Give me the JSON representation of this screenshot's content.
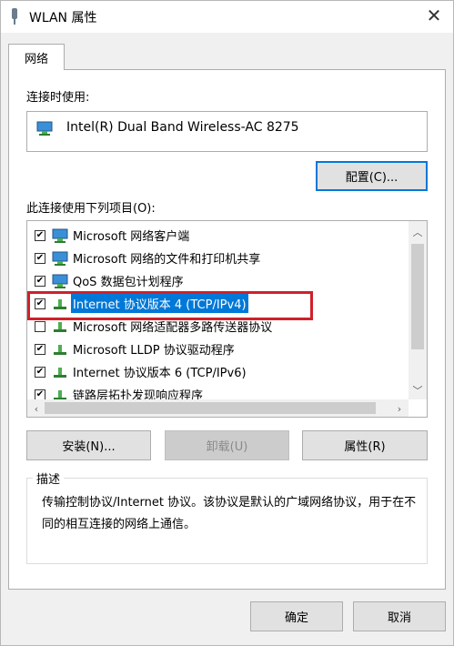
{
  "window": {
    "title": "WLAN 属性",
    "close_glyph": "✕"
  },
  "tabs": [
    {
      "label": "网络"
    }
  ],
  "connect_using": {
    "label": "连接时使用:",
    "adapter": "Intel(R) Dual Band Wireless-AC 8275",
    "icon": "network-adapter-icon"
  },
  "configure_label": "配置(C)...",
  "items_label": "此连接使用下列项目(O):",
  "items": [
    {
      "label": "Microsoft 网络客户端",
      "checked": true,
      "icon": "network-client-icon"
    },
    {
      "label": "Microsoft 网络的文件和打印机共享",
      "checked": true,
      "icon": "network-client-icon"
    },
    {
      "label": "QoS 数据包计划程序",
      "checked": true,
      "icon": "network-client-icon"
    },
    {
      "label": "Internet 协议版本 4 (TCP/IPv4)",
      "checked": true,
      "selected": true,
      "icon": "protocol-icon"
    },
    {
      "label": "Microsoft 网络适配器多路传送器协议",
      "checked": false,
      "icon": "protocol-icon"
    },
    {
      "label": "Microsoft LLDP 协议驱动程序",
      "checked": true,
      "icon": "protocol-icon"
    },
    {
      "label": "Internet 协议版本 6 (TCP/IPv6)",
      "checked": true,
      "icon": "protocol-icon"
    },
    {
      "label": "链路层拓扑发现响应程序",
      "checked": true,
      "icon": "protocol-icon"
    }
  ],
  "buttons": {
    "install": "安装(N)...",
    "uninstall": "卸载(U)",
    "properties": "属性(R)",
    "ok": "确定",
    "cancel": "取消"
  },
  "description": {
    "title": "描述",
    "text": "传输控制协议/Internet 协议。该协议是默认的广域网络协议，用于在不同的相互连接的网络上通信。"
  },
  "colors": {
    "selection": "#0078d7",
    "highlight_box": "#d0202a",
    "focus_border": "#0078d7"
  }
}
